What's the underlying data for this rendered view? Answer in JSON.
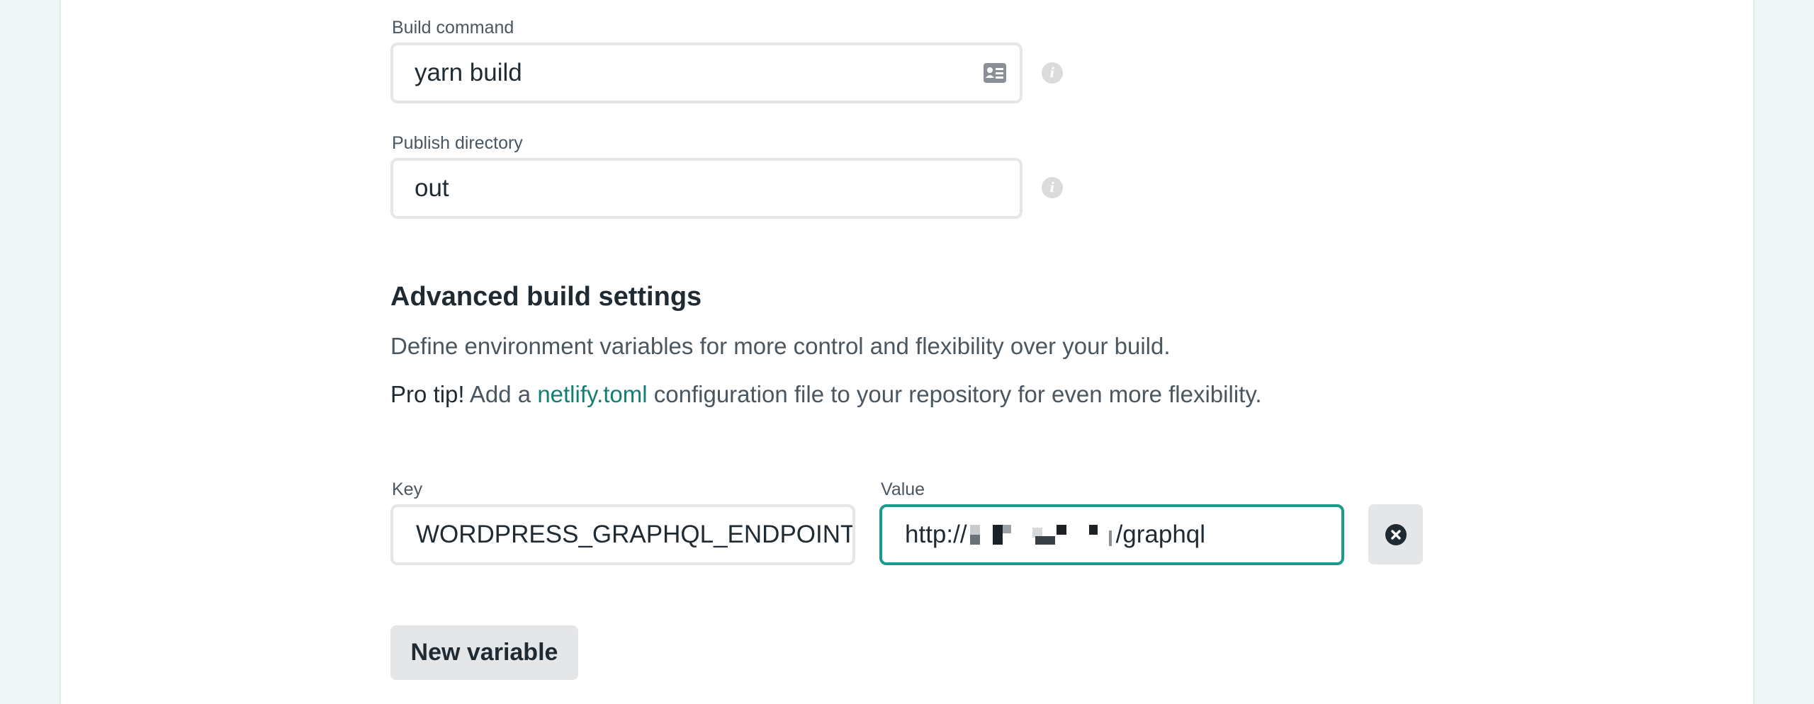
{
  "build_command": {
    "label": "Build command",
    "value": "yarn build",
    "picker_icon": "contact-card-icon",
    "info_icon": "info-icon"
  },
  "publish_directory": {
    "label": "Publish directory",
    "value": "out",
    "info_icon": "info-icon"
  },
  "advanced": {
    "title": "Advanced build settings",
    "description": "Define environment variables for more control and flexibility over your build.",
    "tip_strong": "Pro tip!",
    "tip_pre": " Add a ",
    "tip_link": "netlify.toml",
    "tip_post": " configuration file to your repository for even more flexibility."
  },
  "env_var": {
    "key_label": "Key",
    "key_value": "WORDPRESS_GRAPHQL_ENDPOINT",
    "value_label": "Value",
    "value_prefix": "http://",
    "value_suffix": "/graphql",
    "remove_icon": "close-circle-icon"
  },
  "new_variable_label": "New variable",
  "colors": {
    "accent": "#1a9b8e",
    "link": "#137f74",
    "background": "#eef7f6"
  }
}
